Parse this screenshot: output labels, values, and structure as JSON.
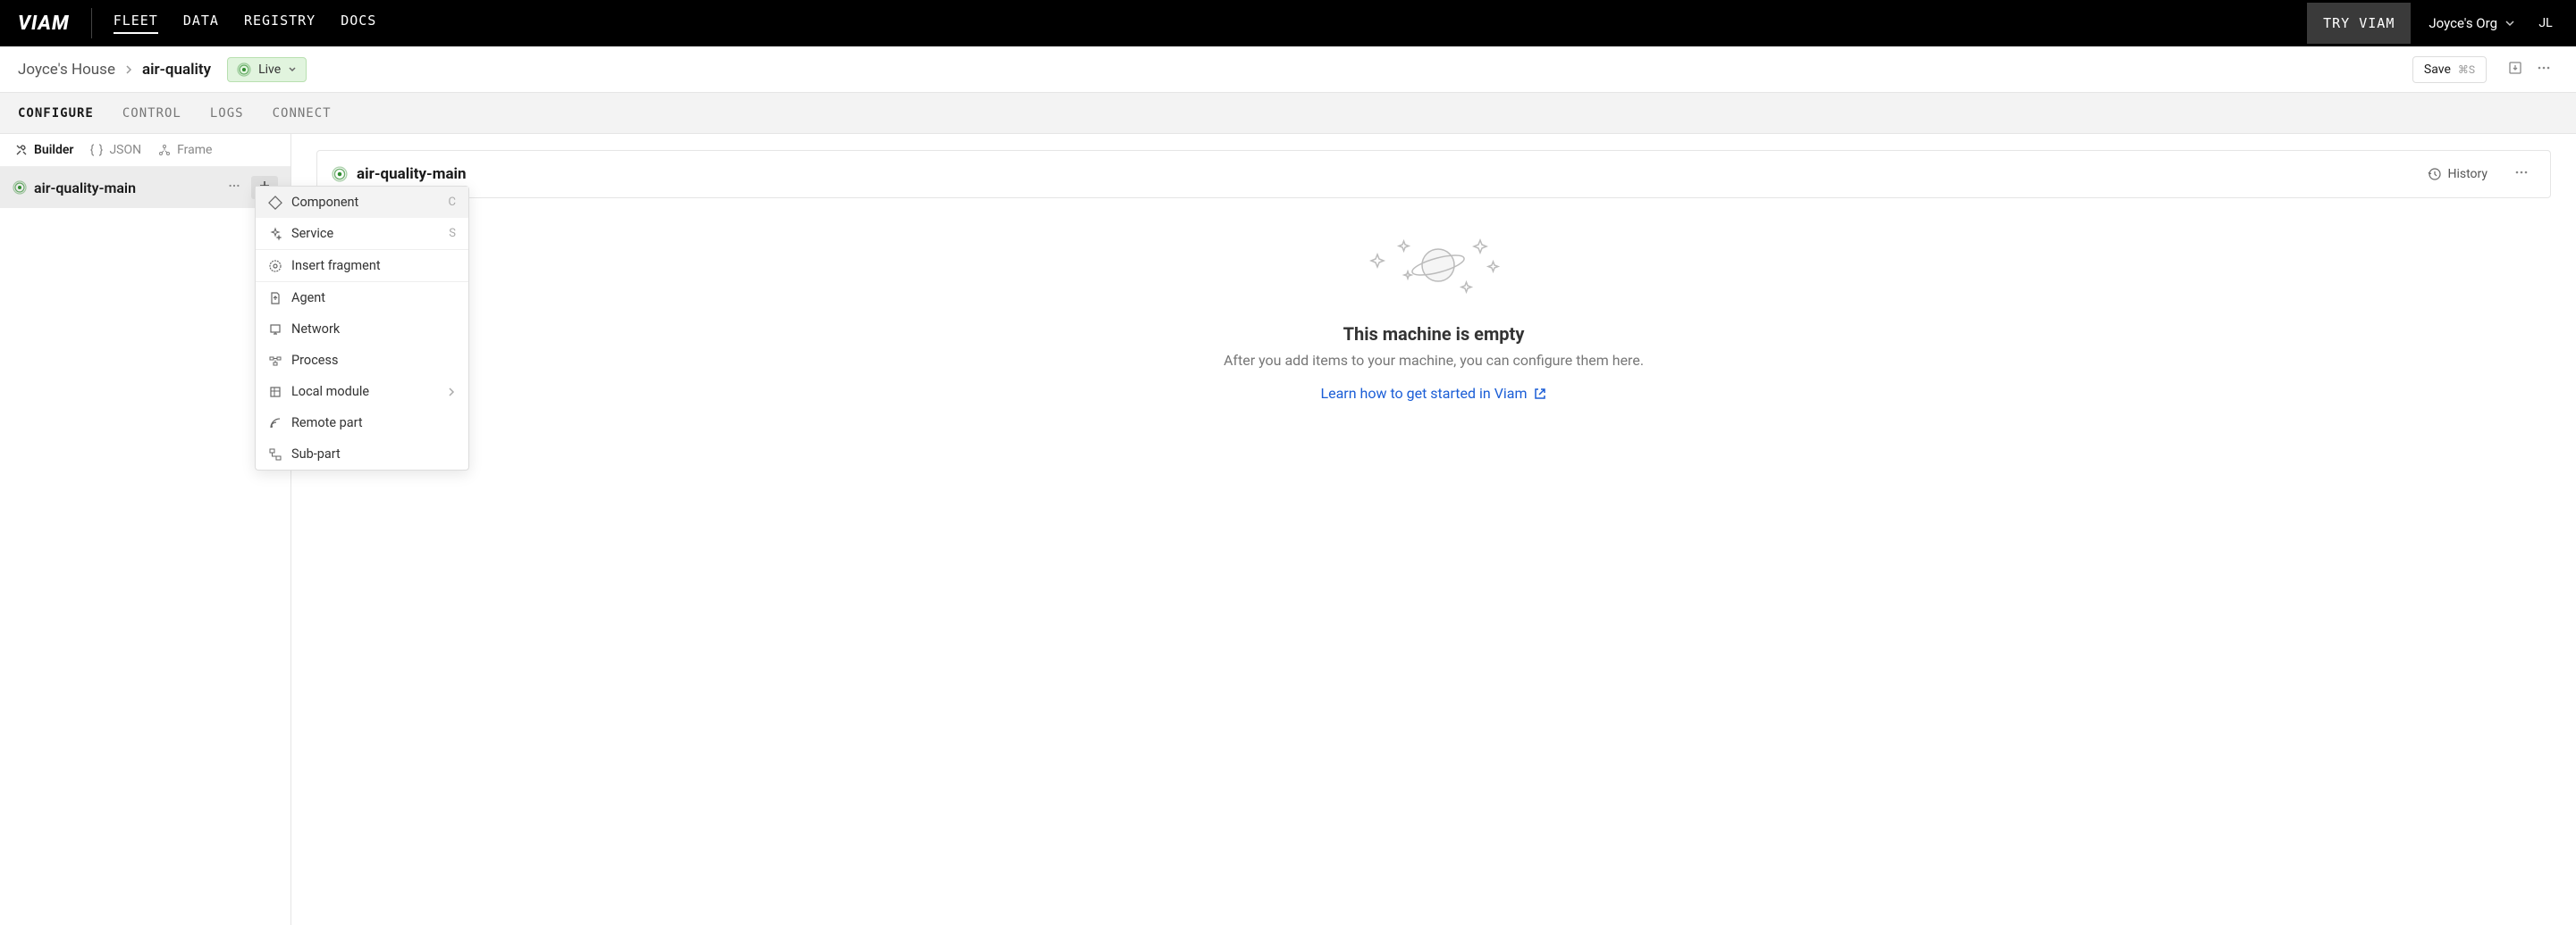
{
  "topnav": {
    "logo": "VIAM",
    "links": [
      "FLEET",
      "DATA",
      "REGISTRY",
      "DOCS"
    ],
    "active": "FLEET",
    "try_label": "TRY VIAM",
    "org_name": "Joyce's Org",
    "avatar_initials": "JL"
  },
  "breadcrumb": {
    "parent": "Joyce's House",
    "current": "air-quality"
  },
  "status": {
    "label": "Live"
  },
  "actions": {
    "save_label": "Save",
    "save_shortcut": "⌘S"
  },
  "tabs": [
    "CONFIGURE",
    "CONTROL",
    "LOGS",
    "CONNECT"
  ],
  "active_tab": "CONFIGURE",
  "sidebar": {
    "tabs": [
      "Builder",
      "JSON",
      "Frame"
    ],
    "active": "Builder",
    "machine_name": "air-quality-main"
  },
  "add_menu": {
    "items": [
      {
        "label": "Component",
        "shortcut": "C",
        "icon": "diamond"
      },
      {
        "label": "Service",
        "shortcut": "S",
        "icon": "sparkle"
      },
      {
        "label": "Insert fragment",
        "icon": "fragment"
      },
      {
        "label": "Agent",
        "icon": "file-arrow"
      },
      {
        "label": "Network",
        "icon": "network"
      },
      {
        "label": "Process",
        "icon": "process"
      },
      {
        "label": "Local module",
        "icon": "module",
        "submenu": true
      },
      {
        "label": "Remote part",
        "icon": "signal"
      },
      {
        "label": "Sub-part",
        "icon": "subpart"
      }
    ]
  },
  "content": {
    "header_title": "air-quality-main",
    "history_label": "History",
    "empty_title": "This machine is empty",
    "empty_desc": "After you add items to your machine, you can configure them here.",
    "learn_link": "Learn how to get started in Viam"
  }
}
